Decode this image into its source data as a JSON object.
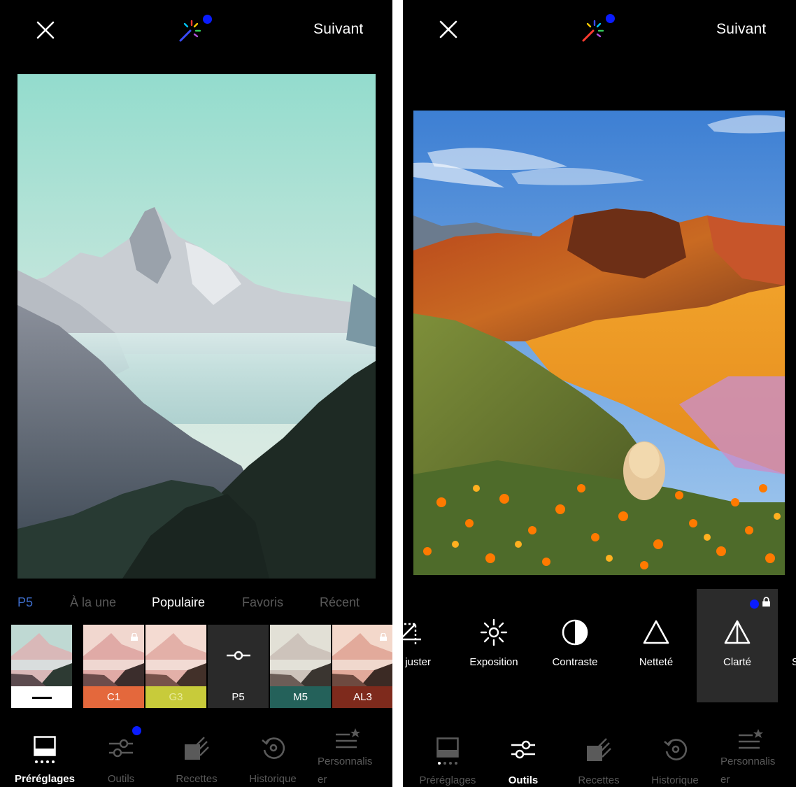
{
  "left_screen": {
    "header": {
      "next_label": "Suivant"
    },
    "tabs": [
      "P5",
      "À la une",
      "Populaire",
      "Favoris",
      "Récent"
    ],
    "active_tab": "Populaire",
    "presets": [
      {
        "label": "—",
        "color": "#ffffff"
      },
      {
        "label": "C1",
        "color": "#e4683c",
        "locked": true
      },
      {
        "label": "G3",
        "color": "#c8cb3a"
      },
      {
        "label": "P5",
        "color": "#2a2a2a",
        "selected": true
      },
      {
        "label": "M5",
        "color": "#24615a"
      },
      {
        "label": "AL3",
        "color": "#7e2a1c",
        "locked": true
      }
    ],
    "bottom_nav": [
      {
        "label": "Préréglages",
        "icon": "presets-icon",
        "active": true
      },
      {
        "label": "Outils",
        "icon": "sliders-icon"
      },
      {
        "label": "Recettes",
        "icon": "recipes-icon"
      },
      {
        "label": "Historique",
        "icon": "history-icon"
      },
      {
        "label_line1": "Personnalis",
        "label_line2": "er",
        "icon": "customize-icon"
      }
    ]
  },
  "right_screen": {
    "header": {
      "next_label": "Suivant"
    },
    "tools": [
      {
        "label": "juster",
        "icon": "adjust-icon"
      },
      {
        "label": "Exposition",
        "icon": "exposure-icon"
      },
      {
        "label": "Contraste",
        "icon": "contrast-icon"
      },
      {
        "label": "Netteté",
        "icon": "sharpen-icon"
      },
      {
        "label": "Clarté",
        "icon": "clarity-icon",
        "selected": true,
        "locked": true
      },
      {
        "label": "S",
        "icon": ""
      }
    ],
    "bottom_nav": [
      {
        "label": "Préréglages",
        "icon": "presets-icon"
      },
      {
        "label": "Outils",
        "icon": "sliders-icon",
        "active": true
      },
      {
        "label": "Recettes",
        "icon": "recipes-icon"
      },
      {
        "label": "Historique",
        "icon": "history-icon"
      },
      {
        "label_line1": "Personnalis",
        "label_line2": "er",
        "icon": "customize-icon"
      }
    ]
  },
  "colors": {
    "notification_dot": "#0a1cff",
    "active_tab": "#ffffff",
    "inactive": "#5a5a5a",
    "selected_bg": "#2b2b2b"
  }
}
